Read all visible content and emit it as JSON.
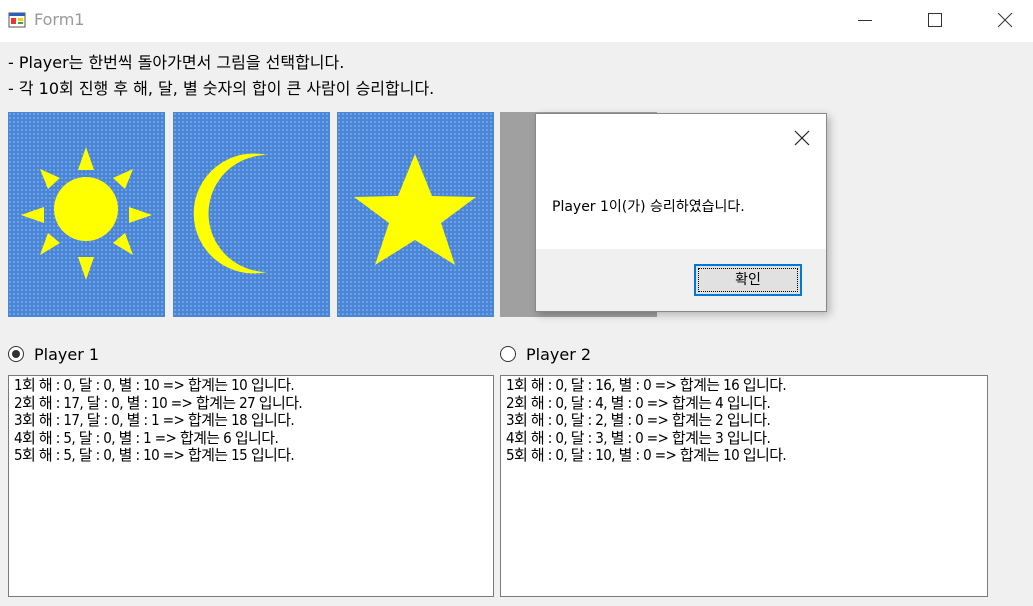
{
  "window": {
    "title": "Form1",
    "icon": "winforms-app-icon"
  },
  "instructions": [
    "- Player는 한번씩 돌아가면서 그림을 선택합니다.",
    "- 각 10회 진행 후 해, 달, 별 숫자의 합이 큰 사람이 승리합니다."
  ],
  "pictures": [
    {
      "icon": "sun-icon"
    },
    {
      "icon": "moon-icon"
    },
    {
      "icon": "star-icon"
    }
  ],
  "players": [
    {
      "label": "Player 1",
      "selected": true,
      "log": [
        "1회 해 : 0, 달 : 0, 별 : 10 => 합계는 10 입니다.",
        "2회 해 : 17, 달 : 0, 별 : 10 => 합계는 27 입니다.",
        "3회 해 : 17, 달 : 0, 별 : 1 => 합계는 18 입니다.",
        "4회 해 : 5, 달 : 0, 별 : 1 => 합계는 6 입니다.",
        "5회 해 : 5, 달 : 0, 별 : 10 => 합계는 15 입니다."
      ]
    },
    {
      "label": "Player 2",
      "selected": false,
      "log": [
        "1회 해 : 0, 달 : 16, 별 : 0 => 합계는 16 입니다.",
        "2회 해 : 0, 달 : 4, 별 : 0 => 합계는 4 입니다.",
        "3회 해 : 0, 달 : 2, 별 : 0 => 합계는 2 입니다.",
        "4회 해 : 0, 달 : 3, 별 : 0 => 합계는 3 입니다.",
        "5회 해 : 0, 달 : 10, 별 : 0 => 합계는 10 입니다."
      ]
    }
  ],
  "dialog": {
    "message": "Player 1이(가) 승리하였습니다.",
    "ok_label": "확인"
  },
  "colors": {
    "picture_bg": "#4a86d8",
    "shape_yellow": "#ffff00",
    "accent": "#0078d7"
  }
}
